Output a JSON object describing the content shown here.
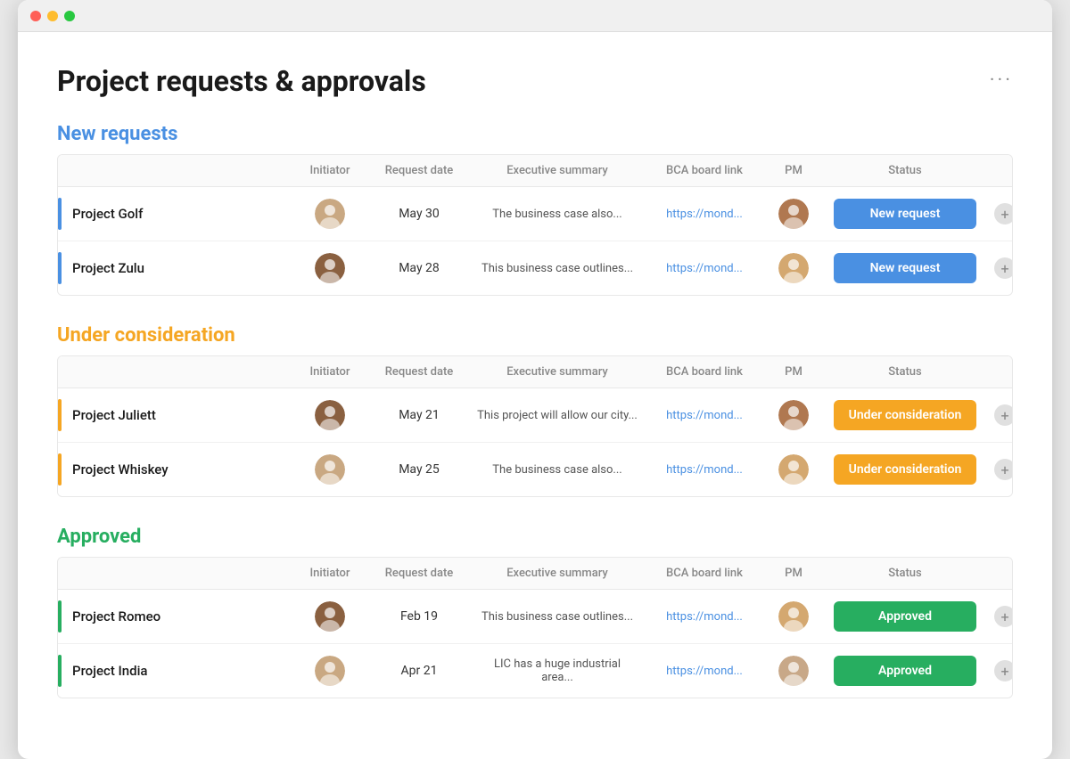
{
  "page": {
    "title": "Project requests & approvals",
    "more_icon": "···"
  },
  "sections": [
    {
      "id": "new-requests",
      "heading": "New requests",
      "color": "blue",
      "accent": "accent-blue",
      "columns": [
        "",
        "Initiator",
        "Request date",
        "Executive summary",
        "BCA board link",
        "PM",
        "Status",
        ""
      ],
      "rows": [
        {
          "name": "Project Golf",
          "initiator_avatar": "av1",
          "request_date": "May 30",
          "summary": "The business case also...",
          "bca_link": "https://mond...",
          "pm_avatar": "av2",
          "status": "New request",
          "status_class": "status-new"
        },
        {
          "name": "Project Zulu",
          "initiator_avatar": "av3",
          "request_date": "May 28",
          "summary": "This business case outlines...",
          "bca_link": "https://mond...",
          "pm_avatar": "av4",
          "status": "New request",
          "status_class": "status-new"
        }
      ]
    },
    {
      "id": "under-consideration",
      "heading": "Under consideration",
      "color": "orange",
      "accent": "accent-orange",
      "columns": [
        "",
        "Initiator",
        "Request date",
        "Executive summary",
        "BCA board link",
        "PM",
        "Status",
        ""
      ],
      "rows": [
        {
          "name": "Project Juliett",
          "initiator_avatar": "av3",
          "request_date": "May 21",
          "summary": "This project will allow our city...",
          "bca_link": "https://mond...",
          "pm_avatar": "av2",
          "status": "Under consideration",
          "status_class": "status-consideration"
        },
        {
          "name": "Project Whiskey",
          "initiator_avatar": "av1",
          "request_date": "May 25",
          "summary": "The business case also...",
          "bca_link": "https://mond...",
          "pm_avatar": "av4",
          "status": "Under consideration",
          "status_class": "status-consideration"
        }
      ]
    },
    {
      "id": "approved",
      "heading": "Approved",
      "color": "green",
      "accent": "accent-green",
      "columns": [
        "",
        "Initiator",
        "Request date",
        "Executive summary",
        "BCA board link",
        "PM",
        "Status",
        ""
      ],
      "rows": [
        {
          "name": "Project Romeo",
          "initiator_avatar": "av3",
          "request_date": "Feb 19",
          "summary": "This business case outlines...",
          "bca_link": "https://mond...",
          "pm_avatar": "av4",
          "status": "Approved",
          "status_class": "status-approved"
        },
        {
          "name": "Project India",
          "initiator_avatar": "av1",
          "request_date": "Apr 21",
          "summary": "LIC has a huge industrial area...",
          "bca_link": "https://mond...",
          "pm_avatar": "av6",
          "status": "Approved",
          "status_class": "status-approved"
        }
      ]
    }
  ]
}
